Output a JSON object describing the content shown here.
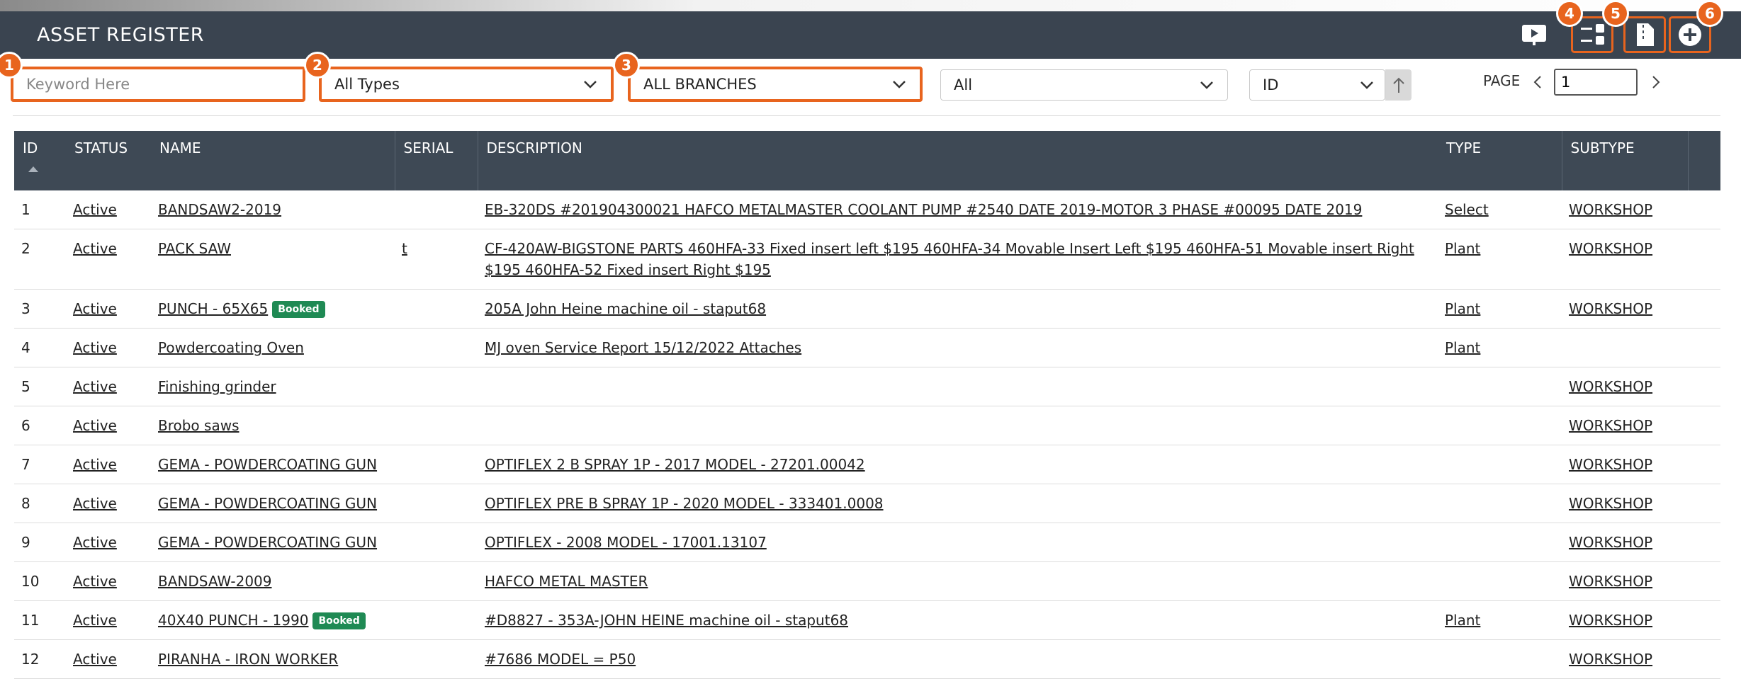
{
  "header": {
    "title": "ASSET REGISTER"
  },
  "markers": [
    "1",
    "2",
    "3",
    "4",
    "5",
    "6"
  ],
  "filters": {
    "keyword_placeholder": "Keyword Here",
    "type": "All Types",
    "branch": "ALL BRANCHES",
    "status": "All",
    "sort_field": "ID"
  },
  "pager": {
    "label": "PAGE",
    "value": "1"
  },
  "table": {
    "columns": [
      "ID",
      "STATUS",
      "NAME",
      "SERIAL",
      "DESCRIPTION",
      "TYPE",
      "SUBTYPE"
    ],
    "badge_label": "Booked",
    "rows": [
      {
        "id": "1",
        "status": "Active",
        "name": "BANDSAW2-2019",
        "serial": "",
        "description": "EB-320DS #201904300021 HAFCO METALMASTER COOLANT PUMP #2540 DATE 2019-MOTOR 3 PHASE #00095 DATE 2019",
        "type": "Select",
        "subtype": "WORKSHOP"
      },
      {
        "id": "2",
        "status": "Active",
        "name": "PACK SAW",
        "serial": "t",
        "description": "CF-420AW-BIGSTONE PARTS 460HFA-33 Fixed insert left $195 460HFA-34 Movable Insert Left $195 460HFA-51 Movable insert Right $195 460HFA-52 Fixed insert Right $195",
        "type": "Plant",
        "subtype": "WORKSHOP"
      },
      {
        "id": "3",
        "status": "Active",
        "name": "PUNCH - 65X65",
        "serial": "",
        "description": "205A John Heine machine oil - staput68",
        "type": "Plant",
        "subtype": "WORKSHOP"
      },
      {
        "id": "4",
        "status": "Active",
        "name": "Powdercoating Oven",
        "serial": "",
        "description": "MJ oven Service Report 15/12/2022 Attaches",
        "type": "Plant",
        "subtype": ""
      },
      {
        "id": "5",
        "status": "Active",
        "name": "Finishing grinder",
        "serial": "",
        "description": "",
        "type": "",
        "subtype": "WORKSHOP"
      },
      {
        "id": "6",
        "status": "Active",
        "name": "Brobo saws",
        "serial": "",
        "description": "",
        "type": "",
        "subtype": "WORKSHOP"
      },
      {
        "id": "7",
        "status": "Active",
        "name": "GEMA - POWDERCOATING GUN",
        "serial": "",
        "description": "OPTIFLEX 2 B SPRAY 1P - 2017 MODEL - 27201.00042",
        "type": "",
        "subtype": "WORKSHOP"
      },
      {
        "id": "8",
        "status": "Active",
        "name": "GEMA - POWDERCOATING GUN",
        "serial": "",
        "description": "OPTIFLEX PRE B SPRAY 1P - 2020 MODEL - 333401.0008",
        "type": "",
        "subtype": "WORKSHOP"
      },
      {
        "id": "9",
        "status": "Active",
        "name": "GEMA - POWDERCOATING GUN",
        "serial": "",
        "description": "OPTIFLEX - 2008 MODEL - 17001.13107",
        "type": "",
        "subtype": "WORKSHOP"
      },
      {
        "id": "10",
        "status": "Active",
        "name": "BANDSAW-2009",
        "serial": "",
        "description": "HAFCO METAL MASTER",
        "type": "",
        "subtype": "WORKSHOP"
      },
      {
        "id": "11",
        "status": "Active",
        "name": "40X40 PUNCH - 1990",
        "serial": "",
        "description": "#D8827 - 353A-JOHN HEINE machine oil - staput68",
        "type": "Plant",
        "subtype": "WORKSHOP"
      },
      {
        "id": "12",
        "status": "Active",
        "name": "PIRANHA - IRON WORKER",
        "serial": "",
        "description": "#7686 MODEL = P50",
        "type": "",
        "subtype": "WORKSHOP"
      }
    ]
  },
  "icons": {
    "presentation": "presentation-icon",
    "list": "list-view-icon",
    "document": "document-icon",
    "add": "add-circle-icon",
    "sort": "sort-ascending-icon",
    "prev": "chevron-left-icon",
    "next": "chevron-right-icon"
  },
  "colors": {
    "header": "#3a4450",
    "accent": "#e8641e",
    "badge": "#1f8a54"
  }
}
